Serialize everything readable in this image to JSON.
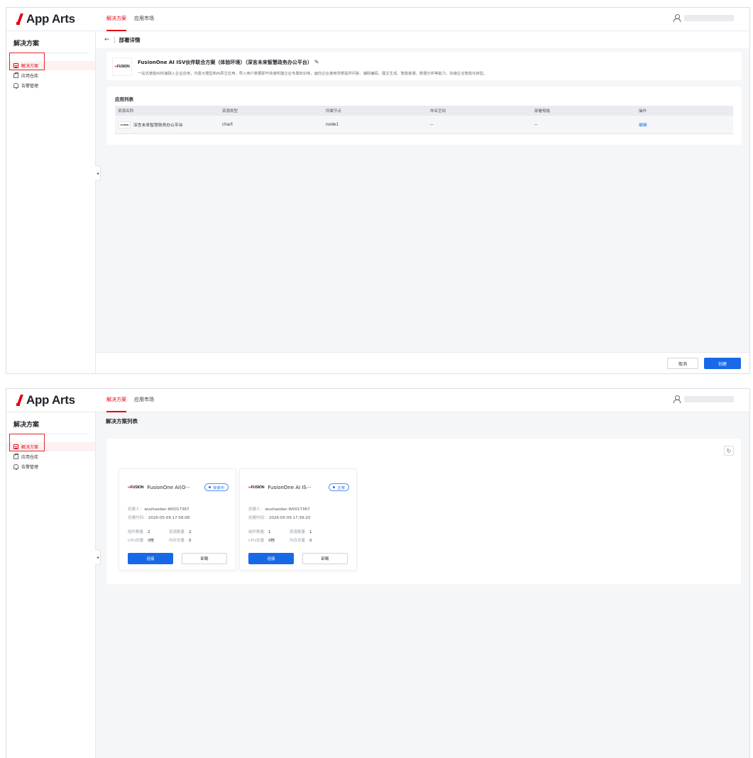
{
  "app": {
    "logo_text": "App Arts",
    "brand_color": "#e60012",
    "primary_color": "#1769e8"
  },
  "topnav": {
    "tabs": [
      "解决方案",
      "应用市场"
    ],
    "active": "解决方案"
  },
  "sidebar": {
    "title": "解决方案",
    "items": [
      {
        "label": "解决方案",
        "icon": "solution-icon",
        "active": true
      },
      {
        "label": "应用仓库",
        "icon": "repository-icon",
        "active": false
      },
      {
        "label": "告警管理",
        "icon": "bell-icon",
        "active": false
      }
    ]
  },
  "detail": {
    "page_title": "部署详情",
    "solution": {
      "logo_text": "FUSION",
      "name": "FusionOne AI ISV伙伴联合方案（体验环境）（深言未来智慧政务办公平台）",
      "description": "一站式使能AI快速融入企业应用，内置大模型和AI原生应用，导入用户数据即可快速构建企业专属知识库，面向企业通用场景提供问答、辅助编码、图文生成、智能客服、数据分析等能力，加速企业智能化转型。"
    },
    "app_list": {
      "title": "应用列表",
      "columns": [
        "资源名称",
        "资源类型",
        "所属节点",
        "命名空间",
        "部署规格",
        "操作"
      ],
      "rows": [
        {
          "name": "深言未来智慧政务办公平台",
          "type": "chart",
          "node": "node1",
          "namespace": "--",
          "spec": "--",
          "action": "编辑"
        }
      ]
    },
    "footer": {
      "cancel": "取消",
      "create": "创建"
    }
  },
  "list": {
    "page_title": "解决方案列表",
    "cards": [
      {
        "logo_text": "FUSION",
        "name": "FusionOne AI(O···",
        "status": "安装中",
        "creator_label": "创建人:",
        "creator": "wushaodan W0017367",
        "created_label": "创建时间:",
        "created": "2026-05-09 17:58:08",
        "components_label": "组件数量",
        "components": "2",
        "resources_label": "资源数量",
        "resources": "2",
        "cpu_label": "CPU总量",
        "cpu": "0核",
        "memory_label": "内存总量",
        "memory": "0",
        "btn_primary": "连接",
        "btn_secondary": "卸载"
      },
      {
        "logo_text": "FUSION",
        "name": "FusionOne AI IS···",
        "status": "正常",
        "creator_label": "创建人:",
        "creator": "wushaodan W0017367",
        "created_label": "创建时间:",
        "created": "2026-05-09 17:39:20",
        "components_label": "组件数量",
        "components": "1",
        "resources_label": "资源数量",
        "resources": "1",
        "cpu_label": "CPU总量",
        "cpu": "0核",
        "memory_label": "内存总量",
        "memory": "0",
        "btn_primary": "连接",
        "btn_secondary": "卸载"
      }
    ]
  }
}
